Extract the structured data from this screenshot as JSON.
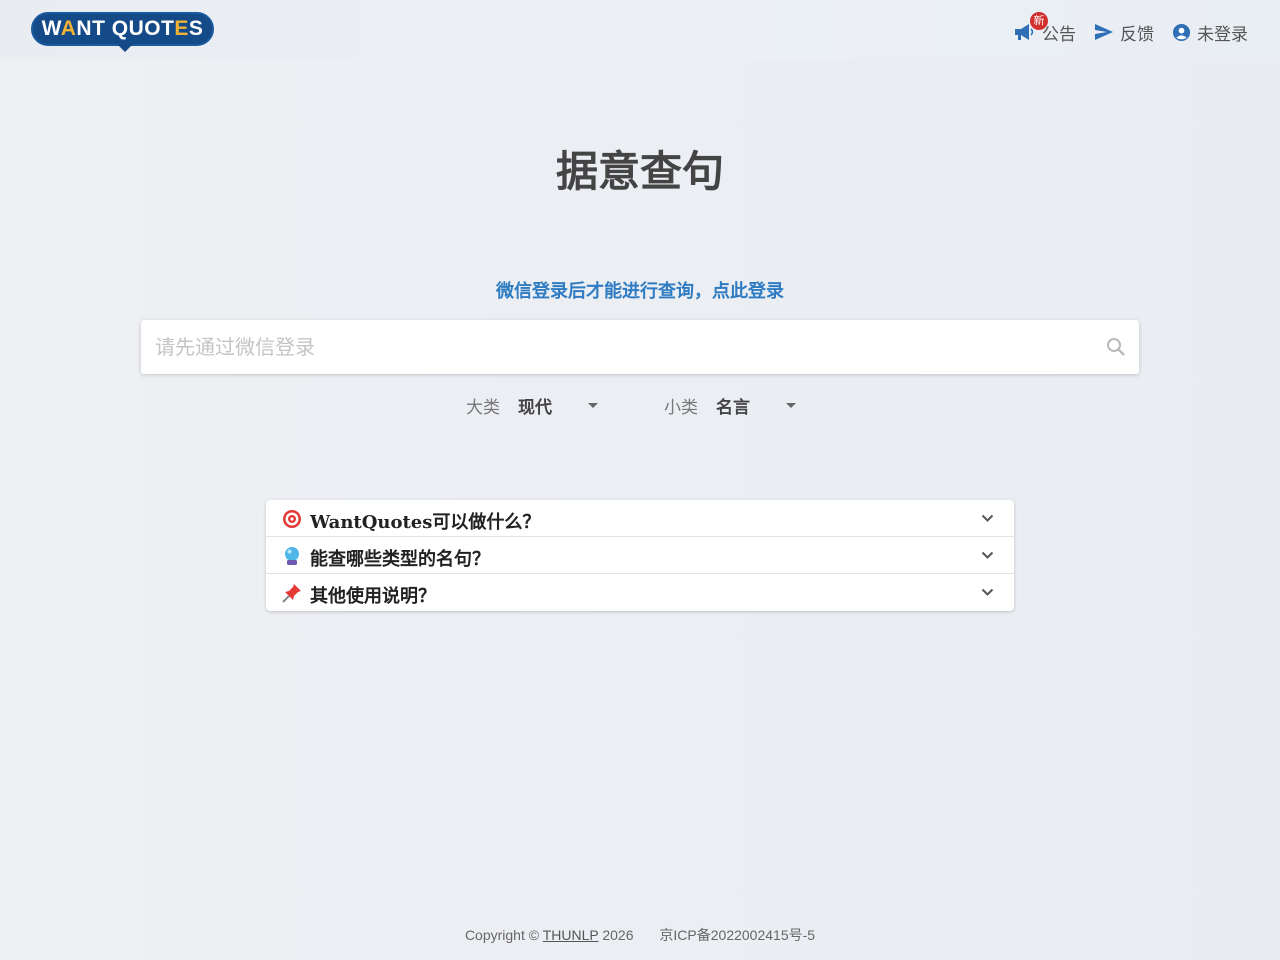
{
  "logo": {
    "text_a": "W",
    "text_b": "A",
    "text_c": "NT QUOT",
    "text_d": "E",
    "text_e": "S"
  },
  "nav": {
    "announce_label": "公告",
    "new_badge": "新",
    "feedback_label": "反馈",
    "login_label": "未登录"
  },
  "page_title": "据意查句",
  "login_prompt": "微信登录后才能进行查询，点此登录",
  "search": {
    "placeholder": "请先通过微信登录"
  },
  "selectors": {
    "major": {
      "label": "大类",
      "value": "现代"
    },
    "minor": {
      "label": "小类",
      "value": "名言"
    }
  },
  "faq": [
    {
      "emoji": "target",
      "text": "WantQuotes可以做什么？"
    },
    {
      "emoji": "crystal-ball",
      "text": "能查哪些类型的名句？"
    },
    {
      "emoji": "pushpin",
      "text": "其他使用说明？"
    }
  ],
  "footer": {
    "copyright_prefix": "Copyright ©",
    "org": "THUNLP",
    "year": "2026",
    "icp": "京ICP备2022002415号-5"
  },
  "colors": {
    "brand": "#134a87",
    "accent": "#f2b233",
    "link": "#2f7cc3",
    "badge": "#d32f2f"
  }
}
